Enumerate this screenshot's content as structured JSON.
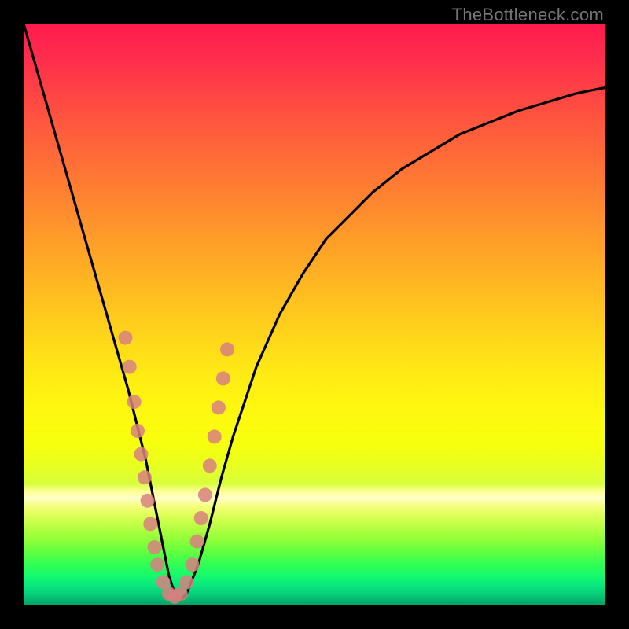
{
  "watermark": "TheBottleneck.com",
  "chart_data": {
    "type": "line",
    "title": "",
    "xlabel": "",
    "ylabel": "",
    "xlim": [
      0,
      100
    ],
    "ylim": [
      0,
      100
    ],
    "series": [
      {
        "name": "bottleneck-curve",
        "x": [
          0,
          2,
          4,
          6,
          8,
          10,
          12,
          14,
          16,
          18,
          19,
          20,
          21,
          22,
          23,
          24,
          25,
          26,
          27,
          28,
          30,
          32,
          34,
          36,
          38,
          40,
          44,
          48,
          52,
          56,
          60,
          65,
          70,
          75,
          80,
          85,
          90,
          95,
          100
        ],
        "y": [
          100,
          93,
          86,
          79,
          72,
          65,
          58,
          51,
          44,
          37,
          33,
          29,
          25,
          20,
          15,
          10,
          5,
          2,
          1,
          2,
          7,
          14,
          22,
          29,
          35,
          41,
          50,
          57,
          63,
          67,
          71,
          75,
          78,
          81,
          83,
          85,
          86.5,
          88,
          89
        ]
      }
    ],
    "markers": {
      "name": "data-points",
      "color": "#d88080",
      "points": [
        {
          "x": 17.5,
          "y": 46
        },
        {
          "x": 18.2,
          "y": 41
        },
        {
          "x": 19.0,
          "y": 35
        },
        {
          "x": 19.6,
          "y": 30
        },
        {
          "x": 20.2,
          "y": 26
        },
        {
          "x": 20.8,
          "y": 22
        },
        {
          "x": 21.3,
          "y": 18
        },
        {
          "x": 21.8,
          "y": 14
        },
        {
          "x": 22.5,
          "y": 10
        },
        {
          "x": 23.0,
          "y": 7
        },
        {
          "x": 24.0,
          "y": 4
        },
        {
          "x": 25.0,
          "y": 2
        },
        {
          "x": 26.0,
          "y": 1.5
        },
        {
          "x": 27.0,
          "y": 2
        },
        {
          "x": 28.0,
          "y": 4
        },
        {
          "x": 29.0,
          "y": 7
        },
        {
          "x": 29.8,
          "y": 11
        },
        {
          "x": 30.5,
          "y": 15
        },
        {
          "x": 31.2,
          "y": 19
        },
        {
          "x": 32.0,
          "y": 24
        },
        {
          "x": 32.8,
          "y": 29
        },
        {
          "x": 33.5,
          "y": 34
        },
        {
          "x": 34.3,
          "y": 39
        },
        {
          "x": 35.0,
          "y": 44
        }
      ]
    }
  }
}
